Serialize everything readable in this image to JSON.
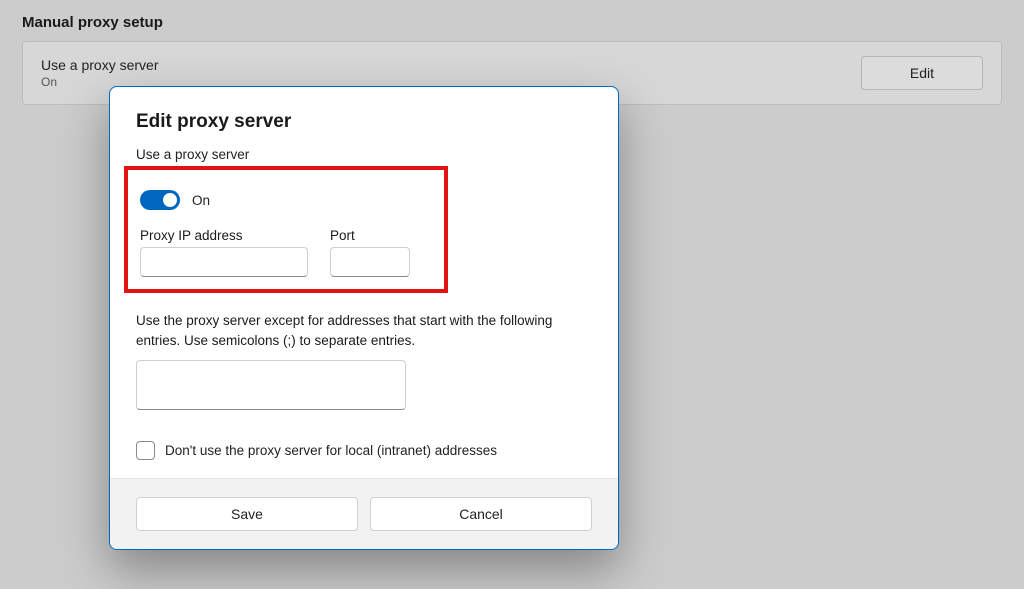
{
  "background": {
    "section_title": "Manual proxy setup",
    "card_primary": "Use a proxy server",
    "card_secondary": "On",
    "edit_label": "Edit"
  },
  "dialog": {
    "title": "Edit proxy server",
    "use_proxy_label": "Use a proxy server",
    "toggle_state_label": "On",
    "ip_label": "Proxy IP address",
    "ip_value": "",
    "port_label": "Port",
    "port_value": "",
    "exceptions_text": "Use the proxy server except for addresses that start with the following entries. Use semicolons (;) to separate entries.",
    "exceptions_value": "",
    "local_checkbox_label": "Don't use the proxy server for local (intranet) addresses",
    "save_label": "Save",
    "cancel_label": "Cancel"
  }
}
